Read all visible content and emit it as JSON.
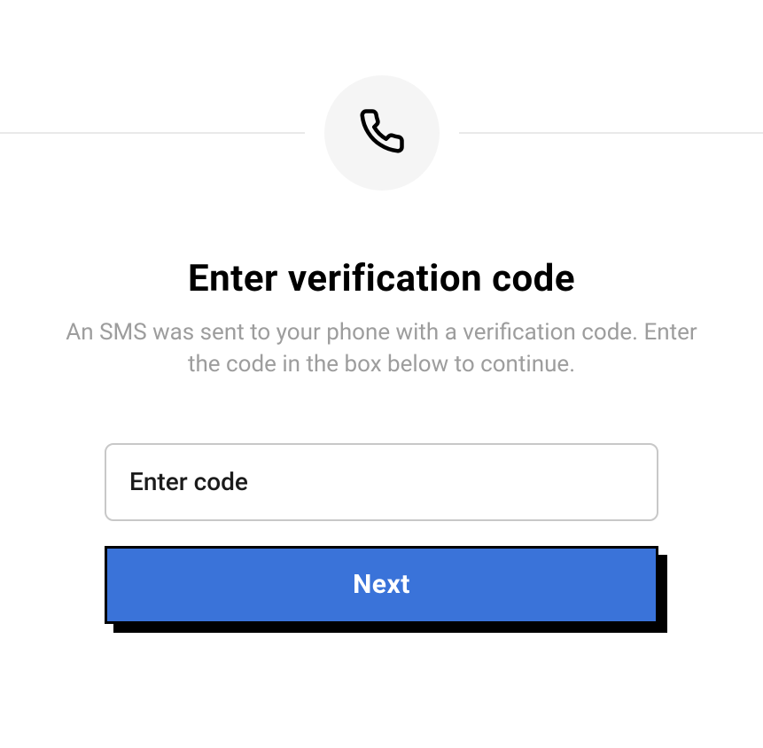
{
  "iconName": "phone-icon",
  "heading": "Enter verification code",
  "description": "An SMS was sent to your phone with a verification code. Enter the code in the box below to continue.",
  "input": {
    "placeholder": "Enter code",
    "value": ""
  },
  "button": {
    "label": "Next"
  }
}
